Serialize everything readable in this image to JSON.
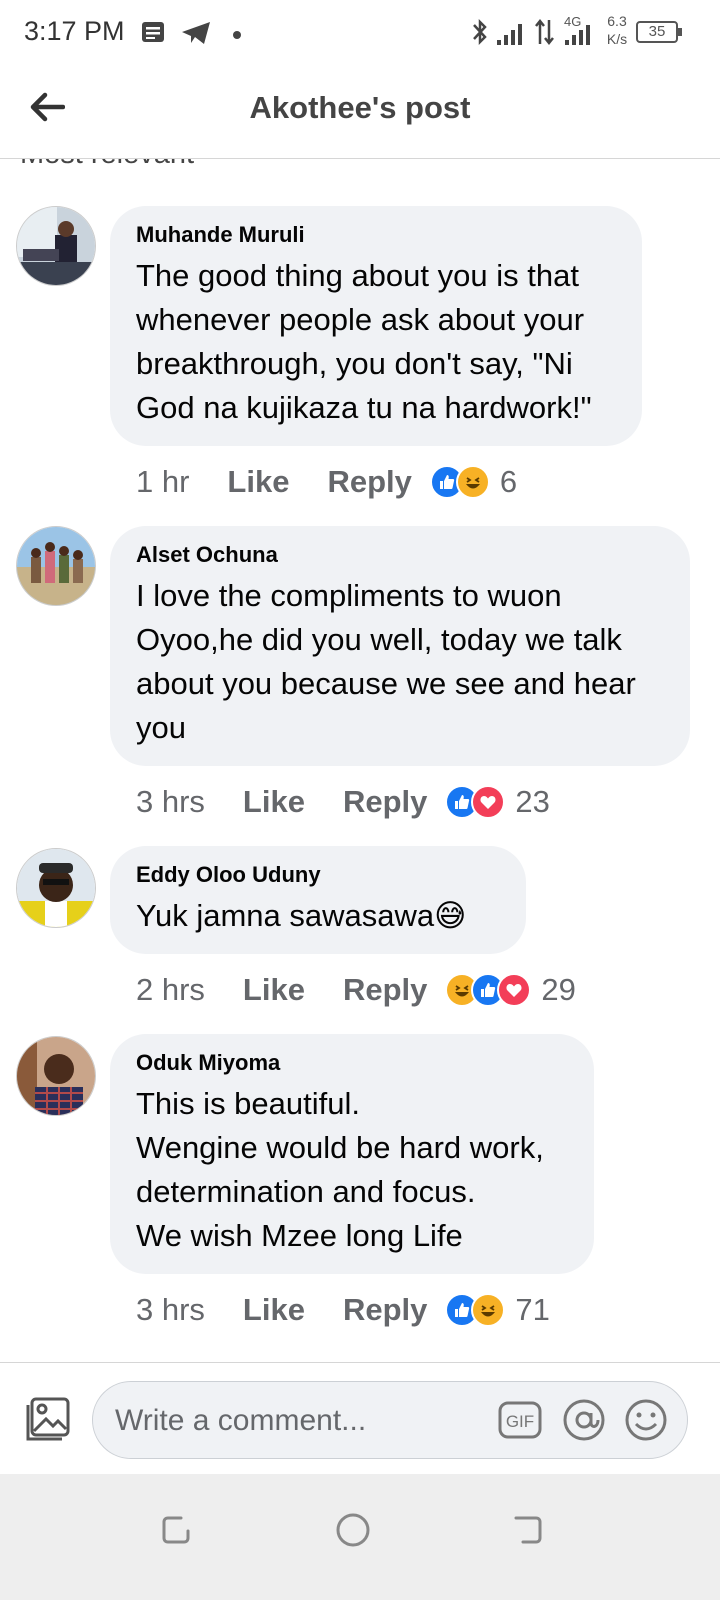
{
  "status_bar": {
    "time": "3:17 PM",
    "network_type": "4G",
    "speed_value": "6.3",
    "speed_unit": "K/s",
    "battery": "35",
    "icons": [
      "message-icon",
      "telegram-icon",
      "dot-icon",
      "bluetooth-icon",
      "signal-icon",
      "data-arrows-icon",
      "signal-4g-icon",
      "battery-icon"
    ]
  },
  "header": {
    "title": "Akothee's post",
    "back_icon": "back-arrow-icon"
  },
  "sort": {
    "label": "Most relevant"
  },
  "comments": [
    {
      "author": "Muhande Muruli",
      "text": "The good thing about you is that\nwhenever people ask about your\nbreakthrough, you don't say, \"Ni\nGod na kujikaza tu na hardwork!\"",
      "time": "1 hr",
      "like_label": "Like",
      "reply_label": "Reply",
      "reactions": [
        "like",
        "haha"
      ],
      "reaction_count": "6"
    },
    {
      "author": "Alset Ochuna",
      "text": "I love the compliments to wuon\nOyoo,he did you well, today we talk\nabout you because we see and hear\nyou",
      "time": "3 hrs",
      "like_label": "Like",
      "reply_label": "Reply",
      "reactions": [
        "like",
        "love"
      ],
      "reaction_count": "23"
    },
    {
      "author": "Eddy Oloo Uduny",
      "text": "Yuk jamna sawasawa😅",
      "time": "2 hrs",
      "like_label": "Like",
      "reply_label": "Reply",
      "reactions": [
        "haha",
        "like",
        "love"
      ],
      "reaction_count": "29"
    },
    {
      "author": "Oduk Miyoma",
      "text": "This is beautiful.\nWengine would be hard work,\ndetermination and focus.\nWe wish Mzee long Life",
      "time": "3 hrs",
      "like_label": "Like",
      "reply_label": "Reply",
      "reactions": [
        "like",
        "haha"
      ],
      "reaction_count": "71"
    }
  ],
  "composer": {
    "placeholder": "Write a comment...",
    "icons": [
      "photo-icon",
      "gif-icon",
      "mention-icon",
      "emoji-icon"
    ]
  },
  "nav": {
    "icons": [
      "recents-icon",
      "home-icon",
      "back-icon"
    ]
  },
  "colors": {
    "bubble": "#f0f2f5",
    "like": "#1877f2",
    "love": "#f33e58",
    "haha": "#f7b125",
    "meta": "#65676b"
  }
}
